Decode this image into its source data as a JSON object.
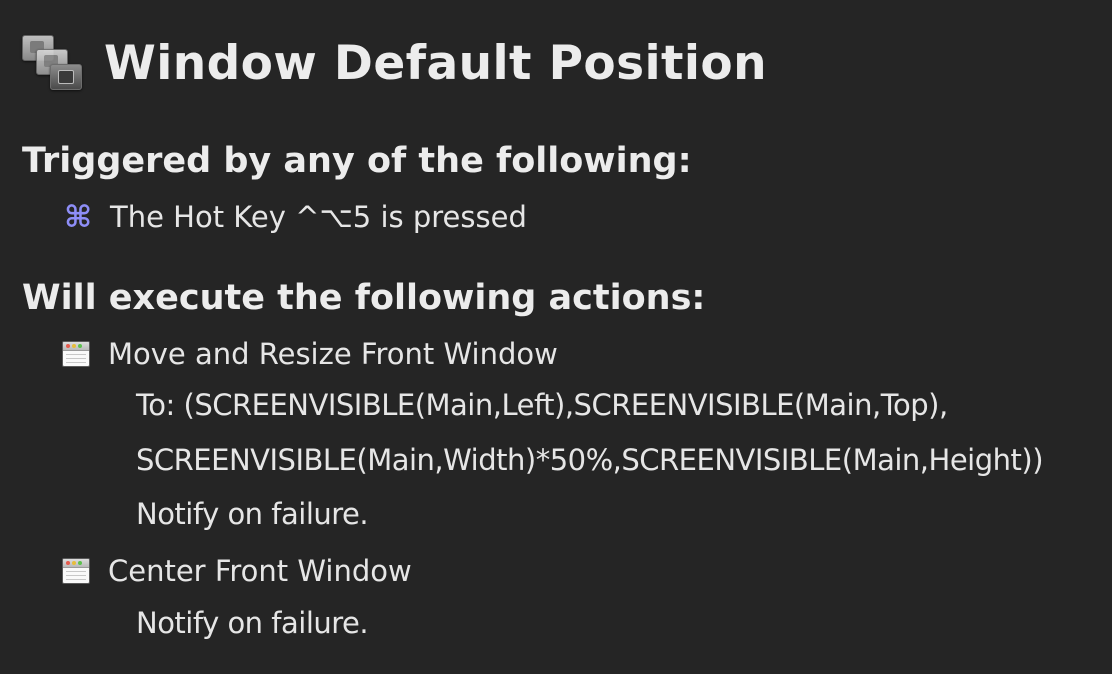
{
  "macro": {
    "title": "Window Default Position",
    "icon": "window-stack-icon"
  },
  "triggers": {
    "heading": "Triggered by any of the following:",
    "items": [
      {
        "icon": "command-key-icon",
        "glyph": "⌘",
        "text": "The Hot Key ^⌥5 is pressed"
      }
    ]
  },
  "actions": {
    "heading": "Will execute the following actions:",
    "items": [
      {
        "icon": "window-action-icon",
        "title": "Move and Resize Front Window",
        "details": [
          "To: (SCREENVISIBLE(Main,Left),SCREENVISIBLE(Main,Top),",
          "SCREENVISIBLE(Main,Width)*50%,SCREENVISIBLE(Main,Height))",
          "Notify on failure."
        ]
      },
      {
        "icon": "window-action-icon",
        "title": "Center Front Window",
        "details": [
          "Notify on failure."
        ]
      }
    ]
  },
  "colors": {
    "background": "#252525",
    "text": "#e6e6e6",
    "command_glyph": "#8e8ef7"
  }
}
